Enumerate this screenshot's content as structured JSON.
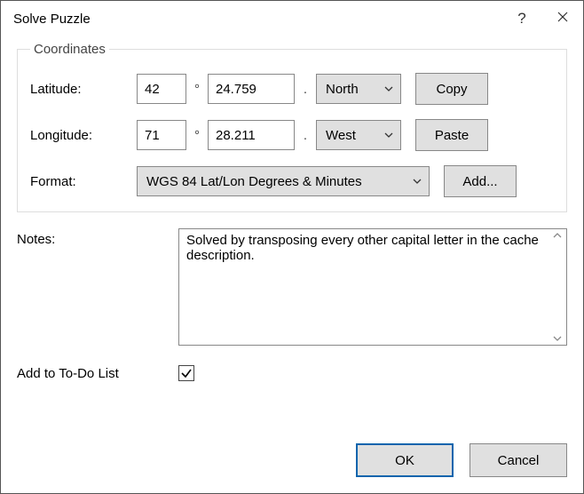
{
  "title": "Solve Puzzle",
  "coords": {
    "legend": "Coordinates",
    "lat_label": "Latitude:",
    "lat_deg": "42",
    "lat_min": "24.759",
    "lat_dir": "North",
    "lon_label": "Longitude:",
    "lon_deg": "71",
    "lon_min": "28.211",
    "lon_dir": "West",
    "deg_symbol": "°",
    "min_symbol": ".",
    "format_label": "Format:",
    "format_value": "WGS 84 Lat/Lon Degrees & Minutes",
    "copy_label": "Copy",
    "paste_label": "Paste",
    "add_label": "Add..."
  },
  "notes": {
    "label": "Notes:",
    "text": "Solved by transposing every other capital letter in the cache description."
  },
  "todo": {
    "label": "Add to To-Do List",
    "checked": true
  },
  "footer": {
    "ok": "OK",
    "cancel": "Cancel"
  }
}
